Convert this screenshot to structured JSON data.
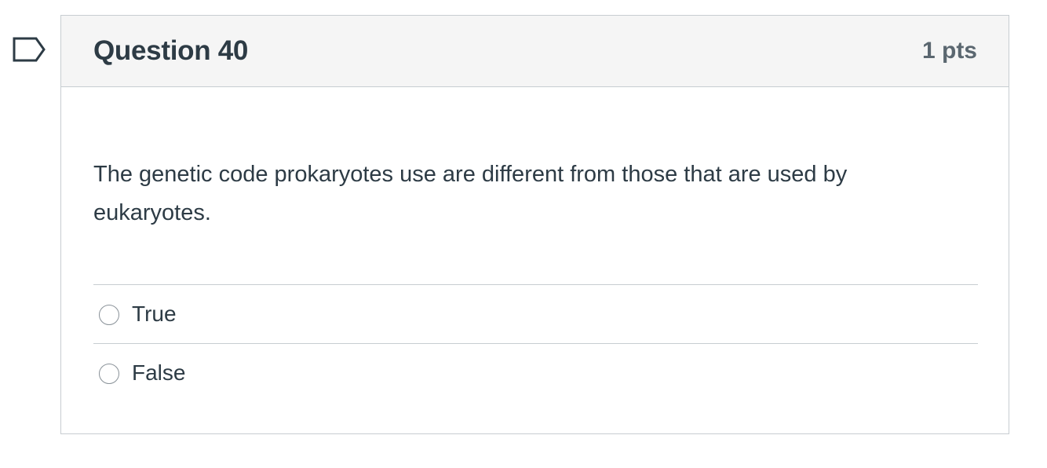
{
  "question": {
    "title": "Question 40",
    "points": "1 pts",
    "text": "The genetic code prokaryotes use are different from those that are used by eukaryotes.",
    "answers": [
      {
        "label": "True"
      },
      {
        "label": "False"
      }
    ]
  },
  "icons": {
    "flag": "bookmark-flag-icon",
    "radio": "radio-button-icon"
  },
  "colors": {
    "text": "#2d3b45",
    "header_bg": "#f5f5f5",
    "border": "#c7cdd1",
    "points": "#5b6770"
  }
}
